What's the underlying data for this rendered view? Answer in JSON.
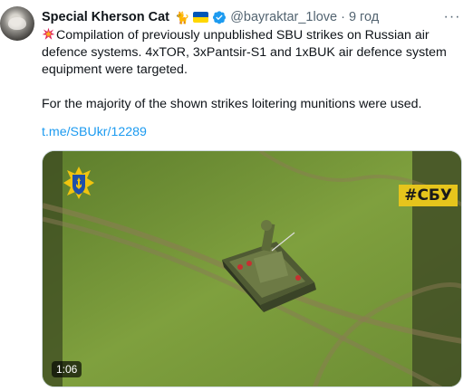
{
  "tweet": {
    "display_name": "Special Kherson Cat",
    "handle": "@bayraktar_1love",
    "separator": "·",
    "time": "9 год",
    "emoji_after_name": "🐈",
    "more_label": "···",
    "text_line1": "Compilation of previously unpublished SBU strikes on Russian air defence systems. 4xTOR, 3xPantsir-S1 and 1xBUK air defence system equipment were targeted.",
    "text_line2": "For the majority of the shown strikes loitering munitions were used.",
    "link": "t.me/SBUkr/12289"
  },
  "media": {
    "hashtag": "#СБУ",
    "duration": "1:06"
  },
  "colors": {
    "link": "#1d9bf0",
    "verified": "#1d9bf0",
    "secondary_text": "#536471",
    "flag_blue": "#0057b7",
    "flag_yellow": "#ffd700",
    "hashtag_bg": "#e6c51c"
  },
  "icons": [
    "collision-icon",
    "cat-emoji",
    "ukraine-flag-emoji",
    "verified-badge-icon",
    "more-options-icon",
    "sbu-emblem-icon"
  ]
}
